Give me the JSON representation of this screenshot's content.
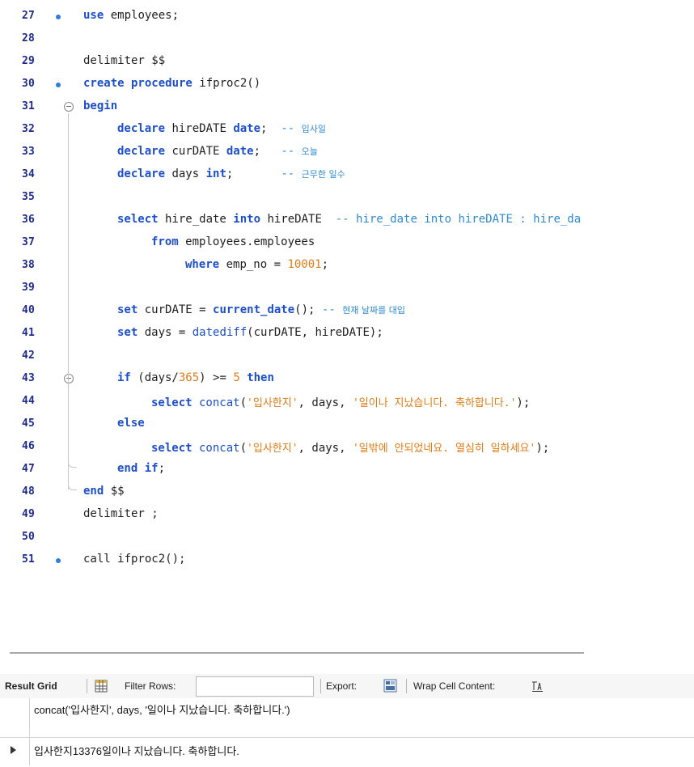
{
  "editor": {
    "lines": [
      {
        "n": "27",
        "dot": true
      },
      {
        "n": "28"
      },
      {
        "n": "29"
      },
      {
        "n": "30",
        "dot": true
      },
      {
        "n": "31"
      },
      {
        "n": "32"
      },
      {
        "n": "33"
      },
      {
        "n": "34"
      },
      {
        "n": "35"
      },
      {
        "n": "36"
      },
      {
        "n": "37"
      },
      {
        "n": "38"
      },
      {
        "n": "39"
      },
      {
        "n": "40"
      },
      {
        "n": "41"
      },
      {
        "n": "42"
      },
      {
        "n": "43"
      },
      {
        "n": "44"
      },
      {
        "n": "45"
      },
      {
        "n": "46"
      },
      {
        "n": "47"
      },
      {
        "n": "48"
      },
      {
        "n": "49"
      },
      {
        "n": "50"
      },
      {
        "n": "51",
        "dot": true
      }
    ],
    "code": {
      "l27_kw": "use",
      "l27_rest": " employees;",
      "l29": "delimiter $$",
      "l30_kw": "create procedure",
      "l30_rest": " ifproc2()",
      "l31_kw": "begin",
      "l32_kw1": "declare",
      "l32_mid": " hireDATE ",
      "l32_kw2": "date",
      "l32_semi": ";  ",
      "l32_c": "-- ",
      "l32_ko": "입사일",
      "l33_kw1": "declare",
      "l33_mid": " curDATE ",
      "l33_kw2": "date",
      "l33_semi": ";   ",
      "l33_c": "-- ",
      "l33_ko": "오늘",
      "l34_kw1": "declare",
      "l34_mid": " days ",
      "l34_kw2": "int",
      "l34_semi": ";       ",
      "l34_c": "-- ",
      "l34_ko": "근무한 일수",
      "l36_kw1": "select",
      "l36_mid": " hire_date ",
      "l36_kw2": "into",
      "l36_rest": " hireDATE  ",
      "l36_c": "-- hire_date into hireDATE : hire_da",
      "l37_kw": "from",
      "l37_rest": " employees.employees",
      "l38_kw": "where",
      "l38_rest": " emp_no = ",
      "l38_num": "10001",
      "l38_semi": ";",
      "l40_kw": "set",
      "l40_mid": " curDATE = ",
      "l40_fn": "current_date",
      "l40_rest": "(); ",
      "l40_c": "-- ",
      "l40_ko": "현재 날짜를 대입",
      "l41_kw": "set",
      "l41_mid": " days = ",
      "l41_fn": "datediff",
      "l41_rest": "(curDATE, hireDATE);",
      "l43_kw1": "if",
      "l43_mid": " (days/",
      "l43_n1": "365",
      "l43_mid2": ") >= ",
      "l43_n2": "5",
      "l43_sp": " ",
      "l43_kw2": "then",
      "l44_kw": "select",
      "l44_fn": " concat",
      "l44_p": "(",
      "l44_s1": "'입사한지'",
      "l44_mid": ", days, ",
      "l44_s2": "'일이나 지났습니다. 축하합니다.'",
      "l44_end": ");",
      "l45_kw": "else",
      "l46_kw": "select",
      "l46_fn": " concat",
      "l46_p": "(",
      "l46_s1": "'입사한지'",
      "l46_mid": ", days, ",
      "l46_s2": "'일밖에 안되었네요. 열심히 일하세요'",
      "l46_end": ");",
      "l47_kw": "end if",
      "l47_semi": ";",
      "l48_kw": "end",
      "l48_rest": " $$",
      "l49": "delimiter ;",
      "l51_rest": "call ifproc2();"
    }
  },
  "toolbar": {
    "result_grid": "Result Grid",
    "filter_rows": "Filter Rows:",
    "filter_value": "",
    "export": "Export:",
    "wrap": "Wrap Cell Content:"
  },
  "grid": {
    "column_header": "concat('입사한지', days, '일이나 지났습니다. 축하합니다.')",
    "cell": "입사한지13376일이나 지났습니다. 축하합니다."
  }
}
